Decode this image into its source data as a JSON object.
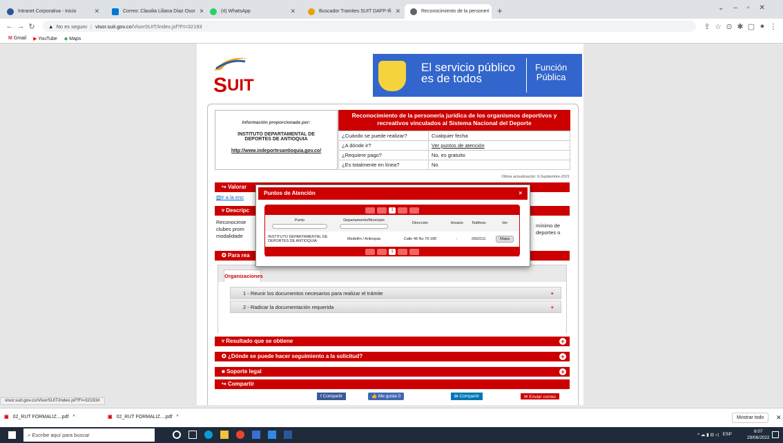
{
  "browser": {
    "tabs": [
      {
        "title": "Intranet Corporativa - Inicio",
        "color": "#2b5797",
        "active": false
      },
      {
        "title": "Correo: Claudia Liliana Díaz Osor",
        "color": "#0078d4",
        "active": false
      },
      {
        "title": "(4) WhatsApp",
        "color": "#25d366",
        "active": false
      },
      {
        "title": "Buscador Tramites SUIT DAFP-Ifi",
        "color": "#e8a000",
        "active": false
      },
      {
        "title": "Reconocimiento de la personeri",
        "color": "#5f6368",
        "active": true
      }
    ],
    "new_tab": "+",
    "not_secure": "No es seguro",
    "url_host": "visor.suit.gov.co",
    "url_path": "/VisorSUIT/index.jsf?FI=32193",
    "bookmarks": [
      "Gmail",
      "YouTube",
      "Maps"
    ]
  },
  "page": {
    "banner_line1": "El servicio público",
    "banner_line2": "es de todos",
    "banner_right1": "Función",
    "banner_right2": "Pública",
    "info_label": "Información proporcionada por:",
    "entity_name": "INSTITUTO DEPARTAMENTAL DE DEPORTES DE ANTIOQUIA",
    "entity_url": "http://www.indeportesantioquia.gov.co/",
    "title": "Reconocimiento de la personería jurídica de los organismos deportivos y recreativos vinculados al Sistema Nacional del Deporte",
    "faq": [
      {
        "q": "¿Cuándo se puede realizar?",
        "a": "Cualquier fecha"
      },
      {
        "q": "¿A dónde ir?",
        "a": "Ver puntos de atención"
      },
      {
        "q": "¿Requiere pago?",
        "a": "No, es gratuito"
      },
      {
        "q": "¿Es totalmente en línea?",
        "a": "No"
      }
    ],
    "last_update": "Última actualización: 9-Septiembre-2021",
    "valorar": "Valorar",
    "ir_link": "Ir a la enc",
    "descripcion": "Descripc",
    "desc_left": [
      "Reconocimie",
      "clubes prom",
      "modalidade"
    ],
    "desc_right": [
      "mínimo de",
      "deportes o"
    ],
    "para_realizar": "Para rea",
    "tab_org": "Organizaciones",
    "steps": [
      "1 - Reunir los documentos necesarios para realizar el trámite",
      "2 - Radicar la documentación requerida"
    ],
    "resultado": "Resultado que se obtiene",
    "seguimiento": "¿Dónde se puede hacer seguimiento a la solicitud?",
    "soporte": "Soporte legal",
    "compartir": "Compartir",
    "share_fb": "Compartir",
    "share_like": "Me gusta 0",
    "share_in": "Compartir",
    "share_mail": "Enviar correo"
  },
  "modal": {
    "title": "Puntos de Atención",
    "close": "×",
    "page": "1",
    "headers": [
      "Punto",
      "Departamento/Municipio",
      "Dirección",
      "Horario",
      "Teléfono",
      "Ver"
    ],
    "row": {
      "punto": "INSTITUTO DEPARTAMENTAL DE DEPORTES DE ANTIOQUIA",
      "depto": "Medellín / Antioquia",
      "dir": "Calle 48 No 70-180",
      "horario": "-",
      "tel": "2602111",
      "ver": "Mapa"
    }
  },
  "status": {
    "url": "visor.suit.gov.co/VisorSUIT/index.jsf?FI=32193#"
  },
  "downloads": {
    "items": [
      "02_RUT FORMALIZ....pdf",
      "02_RUT FORMALIZ....pdf"
    ],
    "show_all": "Mostrar todo"
  },
  "taskbar": {
    "search": "Escribe aquí para buscar",
    "lang": "ESP",
    "time": "8:07",
    "date": "29/06/2022"
  }
}
